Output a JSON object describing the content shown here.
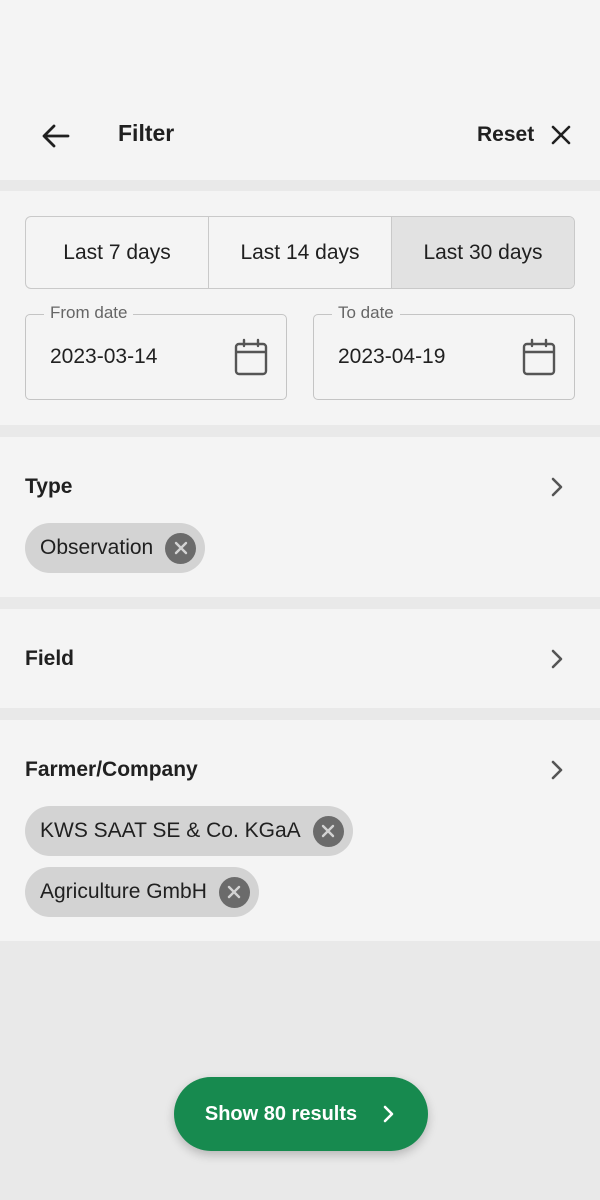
{
  "header": {
    "title": "Filter",
    "reset_label": "Reset"
  },
  "date_range": {
    "presets": [
      "Last 7 days",
      "Last 14 days",
      "Last 30 days"
    ],
    "selected_preset": "Last 30 days",
    "from_label": "From date",
    "from_value": "2023-03-14",
    "to_label": "To date",
    "to_value": "2023-04-19"
  },
  "type": {
    "title": "Type",
    "chips": [
      "Observation"
    ]
  },
  "field": {
    "title": "Field"
  },
  "farmer": {
    "title": "Farmer/Company",
    "chips": [
      "KWS SAAT SE & Co. KGaA",
      "Agriculture GmbH"
    ]
  },
  "footer": {
    "show_label": "Show 80 results"
  },
  "colors": {
    "primary": "#178a4f",
    "section_bg": "#f4f4f4",
    "chip_bg": "#d3d3d3",
    "active_segment": "#e2e2e2"
  },
  "icons": {
    "back": "arrow-left-icon",
    "close": "close-icon",
    "calendar": "calendar-icon",
    "chevron": "chevron-right-icon",
    "chip_remove": "close-circle-icon"
  }
}
